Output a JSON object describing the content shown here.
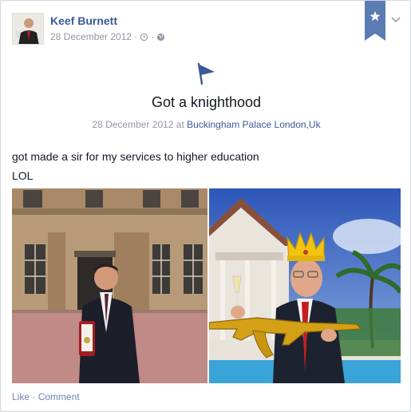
{
  "post": {
    "author": "Keef Burnett",
    "date": "28 December 2012",
    "separator": "·",
    "icons": [
      "clock-icon",
      "globe-icon"
    ],
    "ribbon_icon": "star-icon",
    "menu_icon": "chevron-down-icon"
  },
  "life_event": {
    "icon": "flag-icon",
    "title": "Got a knighthood",
    "date_text": "28 December 2012 at ",
    "location": "Buckingham Palace London,Uk"
  },
  "body": {
    "line1": "got made a sir for my services to higher education",
    "line2": "LOL"
  },
  "photos": [
    {
      "subject": "photo-palace"
    },
    {
      "subject": "photo-crown"
    }
  ],
  "actions": {
    "like": "Like",
    "separator": " · ",
    "comment": "Comment"
  },
  "colors": {
    "link": "#3b5998",
    "meta": "#9197a3",
    "ribbon": "#5b7bb5",
    "action": "#6d84b4"
  }
}
